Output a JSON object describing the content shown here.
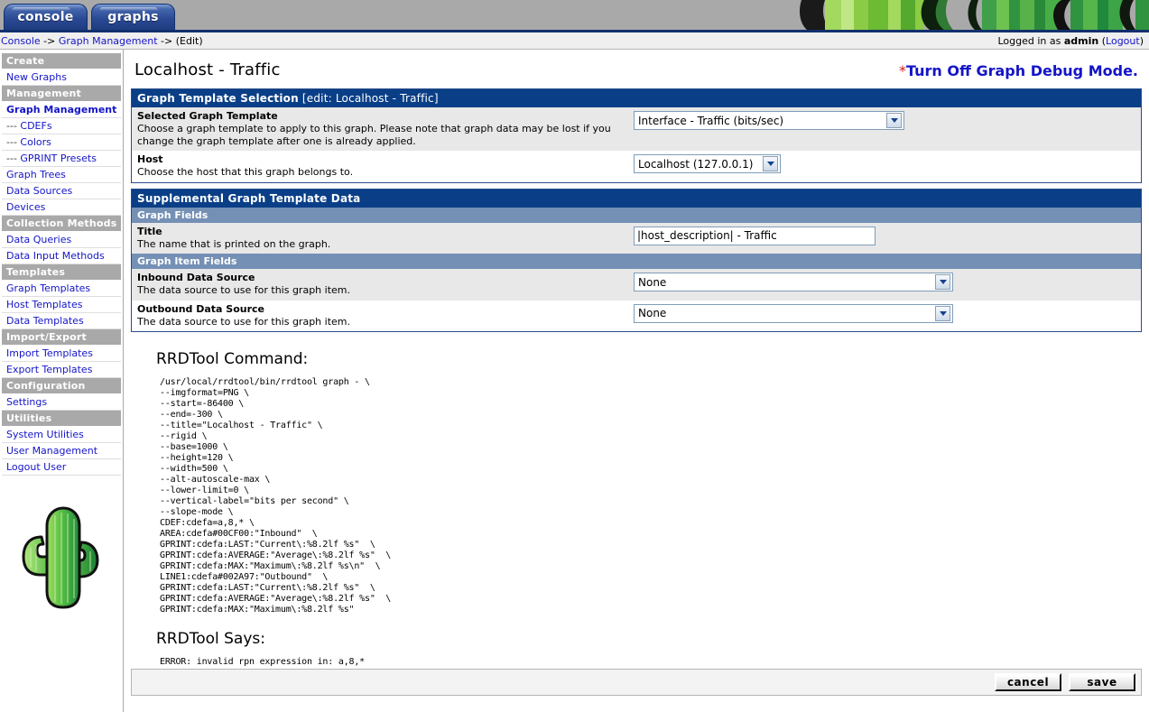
{
  "tabs": [
    {
      "label": "console",
      "name": "tab-console"
    },
    {
      "label": "graphs",
      "name": "tab-graphs"
    }
  ],
  "breadcrumb": {
    "items": [
      "Console",
      "Graph Management"
    ],
    "separator": " -> ",
    "current": "(Edit)"
  },
  "session": {
    "prefix": "Logged in as ",
    "user": "admin",
    "logout_open": " (",
    "logout_label": "Logout",
    "logout_close": ")"
  },
  "sidebar": {
    "groups": [
      {
        "header": "Create",
        "items": [
          {
            "label": "New Graphs",
            "current": false,
            "sub": false
          }
        ]
      },
      {
        "header": "Management",
        "items": [
          {
            "label": "Graph Management",
            "current": true,
            "sub": false
          },
          {
            "label": "CDEFs",
            "current": false,
            "sub": true
          },
          {
            "label": "Colors",
            "current": false,
            "sub": true
          },
          {
            "label": "GPRINT Presets",
            "current": false,
            "sub": true
          },
          {
            "label": "Graph Trees",
            "current": false,
            "sub": false
          },
          {
            "label": "Data Sources",
            "current": false,
            "sub": false
          },
          {
            "label": "Devices",
            "current": false,
            "sub": false
          }
        ]
      },
      {
        "header": "Collection Methods",
        "items": [
          {
            "label": "Data Queries",
            "current": false,
            "sub": false
          },
          {
            "label": "Data Input Methods",
            "current": false,
            "sub": false
          }
        ]
      },
      {
        "header": "Templates",
        "items": [
          {
            "label": "Graph Templates",
            "current": false,
            "sub": false
          },
          {
            "label": "Host Templates",
            "current": false,
            "sub": false
          },
          {
            "label": "Data Templates",
            "current": false,
            "sub": false
          }
        ]
      },
      {
        "header": "Import/Export",
        "items": [
          {
            "label": "Import Templates",
            "current": false,
            "sub": false
          },
          {
            "label": "Export Templates",
            "current": false,
            "sub": false
          }
        ]
      },
      {
        "header": "Configuration",
        "items": [
          {
            "label": "Settings",
            "current": false,
            "sub": false
          }
        ]
      },
      {
        "header": "Utilities",
        "items": [
          {
            "label": "System Utilities",
            "current": false,
            "sub": false
          },
          {
            "label": "User Management",
            "current": false,
            "sub": false
          },
          {
            "label": "Logout User",
            "current": false,
            "sub": false
          }
        ]
      }
    ],
    "sub_prefix": "--- "
  },
  "main": {
    "page_title": "Localhost - Traffic",
    "debug_star": "*",
    "debug_link": "Turn Off Graph Debug Mode."
  },
  "template_selection": {
    "panel_title": "Graph Template Selection",
    "panel_subtitle": " [edit: Localhost - Traffic]",
    "rows": [
      {
        "label": "Selected Graph Template",
        "text": "Choose a graph template to apply to this graph. Please note that graph data may be lost if you change the graph template after one is already applied.",
        "value": "Interface - Traffic (bits/sec)"
      },
      {
        "label": "Host",
        "text": "Choose the host that this graph belongs to.",
        "value": "Localhost (127.0.0.1)"
      }
    ]
  },
  "supplemental": {
    "panel_title": "Supplemental Graph Template Data",
    "graph_fields_head": "Graph Fields",
    "graph_item_fields_head": "Graph Item Fields",
    "title_row": {
      "label": "Title",
      "text": "The name that is printed on the graph.",
      "value": "|host_description| - Traffic"
    },
    "inbound_row": {
      "label": "Inbound Data Source",
      "text": "The data source to use for this graph item.",
      "value": "None"
    },
    "outbound_row": {
      "label": "Outbound Data Source",
      "text": "The data source to use for this graph item.",
      "value": "None"
    }
  },
  "debug": {
    "command_heading": "RRDTool Command:",
    "command": "/usr/local/rrdtool/bin/rrdtool graph - \\\n--imgformat=PNG \\\n--start=-86400 \\\n--end=-300 \\\n--title=\"Localhost - Traffic\" \\\n--rigid \\\n--base=1000 \\\n--height=120 \\\n--width=500 \\\n--alt-autoscale-max \\\n--lower-limit=0 \\\n--vertical-label=\"bits per second\" \\\n--slope-mode \\\nCDEF:cdefa=a,8,* \\\nAREA:cdefa#00CF00:\"Inbound\"  \\\nGPRINT:cdefa:LAST:\"Current\\:%8.2lf %s\"  \\\nGPRINT:cdefa:AVERAGE:\"Average\\:%8.2lf %s\"  \\\nGPRINT:cdefa:MAX:\"Maximum\\:%8.2lf %s\\n\"  \\\nLINE1:cdefa#002A97:\"Outbound\"  \\\nGPRINT:cdefa:LAST:\"Current\\:%8.2lf %s\"  \\\nGPRINT:cdefa:AVERAGE:\"Average\\:%8.2lf %s\"  \\\nGPRINT:cdefa:MAX:\"Maximum\\:%8.2lf %s\"",
    "says_heading": "RRDTool Says:",
    "says": "ERROR: invalid rpn expression in: a,8,*"
  },
  "actions": {
    "cancel_label": "cancel",
    "save_label": "save"
  },
  "colors": {
    "panel_header": "#0a3f87",
    "subhead": "#7590b5",
    "link": "#1414c8",
    "nav_header_bg": "#a9a9a9",
    "banner_bg": "#a9a9a9",
    "cactus_green_light": "#8dd14a",
    "cactus_green_dark": "#1f8a3c",
    "area_color": "#00CF00",
    "line_color": "#002A97"
  }
}
